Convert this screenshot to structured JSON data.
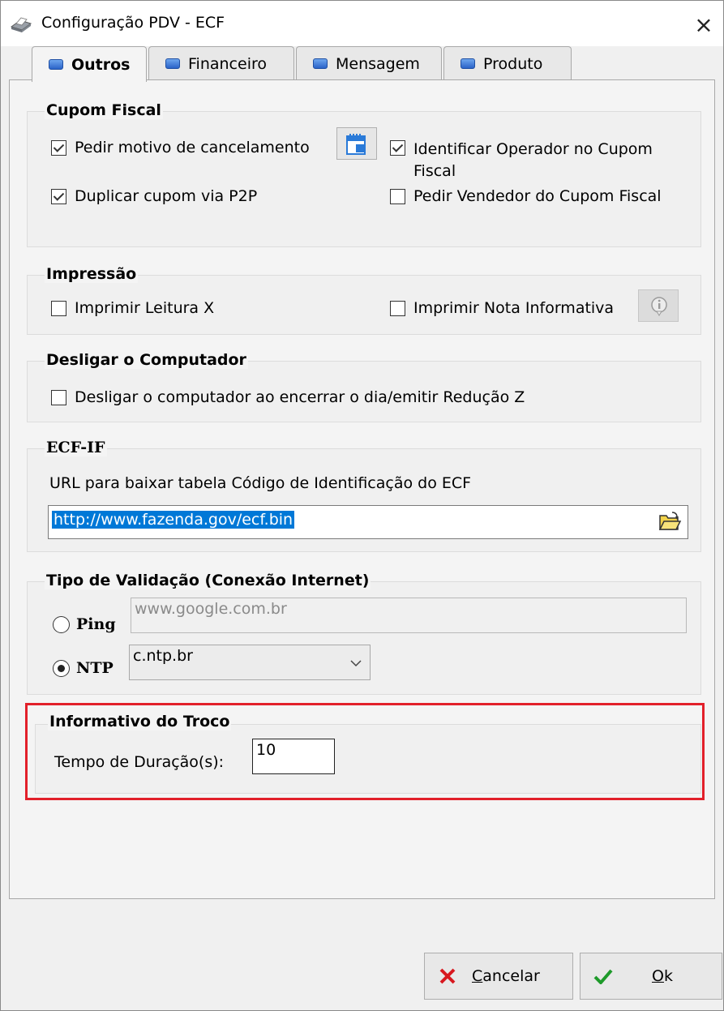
{
  "window": {
    "title": "Configuração PDV - ECF",
    "close_glyph": "×"
  },
  "tabs": [
    {
      "label": "Outros",
      "active": true
    },
    {
      "label": "Financeiro",
      "active": false
    },
    {
      "label": "Mensagem",
      "active": false
    },
    {
      "label": "Produto",
      "active": false
    }
  ],
  "cupom_fiscal": {
    "title": "Cupom Fiscal",
    "pedir_motivo": {
      "label": "Pedir motivo de cancelamento",
      "checked": true
    },
    "identificar_operador": {
      "label_line1": "Identificar Operador no Cupom",
      "label_line2": "Fiscal",
      "checked": true
    },
    "duplicar_cupom": {
      "label": "Duplicar cupom via P2P",
      "checked": true
    },
    "pedir_vendedor": {
      "label": "Pedir Vendedor do Cupom Fiscal",
      "checked": false
    }
  },
  "impressao": {
    "title": "Impressão",
    "leitura_x": {
      "label": "Imprimir Leitura X",
      "checked": false
    },
    "nota_informativa": {
      "label": "Imprimir Nota Informativa",
      "checked": false
    }
  },
  "desligar": {
    "title": "Desligar o Computador",
    "desligar_cb": {
      "label": "Desligar o computador ao encerrar o dia/emitir Redução Z",
      "checked": false
    }
  },
  "ecf_if": {
    "title": "ECF-IF",
    "url_label": "URL para baixar tabela Código de Identificação do ECF",
    "url_value": "http://www.fazenda.gov/ecf.bin"
  },
  "validacao": {
    "title": "Tipo de Validação (Conexão Internet)",
    "ping_label": "Ping",
    "ping_value": "www.google.com.br",
    "ntp_label": "NTP",
    "ntp_value": "c.ntp.br",
    "selected": "NTP"
  },
  "troco": {
    "title": "Informativo do Troco",
    "duracao_label": "Tempo de Duração(s):",
    "duracao_value": "10"
  },
  "buttons": {
    "cancelar_underline": "C",
    "cancelar_rest": "ancelar",
    "ok_underline": "O",
    "ok_rest": "k"
  },
  "colors": {
    "highlight": "#e2202a",
    "selection": "#0078d7",
    "cancel_x": "#d8181f",
    "ok_check": "#1e9a2a"
  }
}
